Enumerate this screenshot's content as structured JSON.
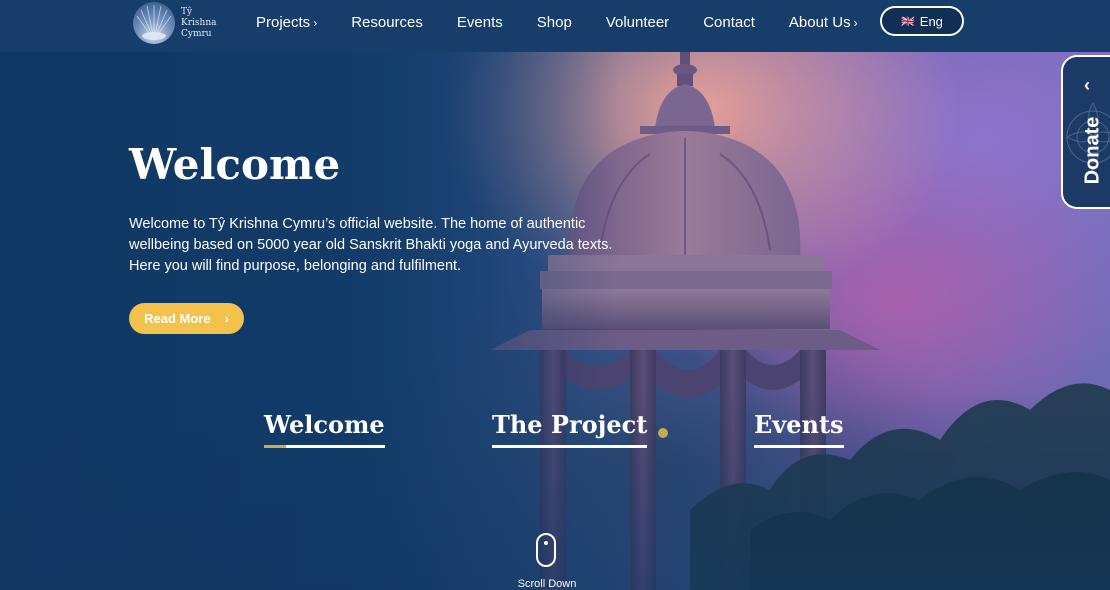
{
  "brand": {
    "logo_text_line1": "Tŷ",
    "logo_text_line2": "Krishna",
    "logo_text_line3": "Cymru"
  },
  "nav": {
    "items": [
      {
        "label": "Projects",
        "has_chevron": true
      },
      {
        "label": "Resources",
        "has_chevron": false
      },
      {
        "label": "Events",
        "has_chevron": false
      },
      {
        "label": "Shop",
        "has_chevron": false
      },
      {
        "label": "Volunteer",
        "has_chevron": false
      },
      {
        "label": "Contact",
        "has_chevron": false
      },
      {
        "label": "About Us",
        "has_chevron": true
      }
    ],
    "chevron": "›",
    "language": {
      "flag": "🇬🇧",
      "label": "Eng"
    }
  },
  "hero": {
    "title": "Welcome",
    "text": "Welcome to Tŷ Krishna Cymru’s official website. The home of authentic wellbeing based on 5000 year old Sanskrit Bhakti yoga and Ayurveda texts. Here you will find purpose, belonging and fulfilment.",
    "button_label": "Read More",
    "button_arrow": "›"
  },
  "tabs": [
    {
      "label": "Welcome",
      "active": true
    },
    {
      "label": "The Project",
      "active": false
    },
    {
      "label": "Events",
      "active": false
    }
  ],
  "scroll": {
    "label": "Scroll Down"
  },
  "donate": {
    "label": "Donate",
    "chevron": "‹"
  },
  "colors": {
    "navbar": "#173e6b",
    "accent": "#f2c24d",
    "text": "#ffffff"
  }
}
